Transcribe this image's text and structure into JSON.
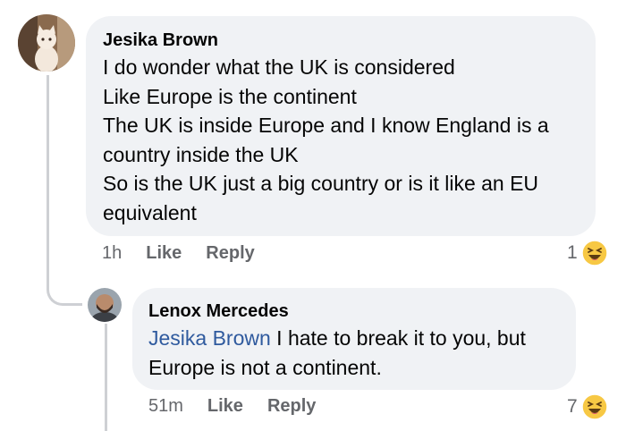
{
  "comments": [
    {
      "author": "Jesika Brown",
      "avatar_icon": "cat-photo-avatar",
      "lines": [
        "I do wonder what the UK is considered",
        "Like Europe is the continent",
        "The UK is inside Europe and I know England is a",
        "country inside the UK",
        "So is the UK just a big country or is it like an EU",
        "equivalent"
      ],
      "time": "1h",
      "like_label": "Like",
      "reply_label": "Reply",
      "reaction_count": "1",
      "reaction_icon": "laughing-emoji-icon"
    },
    {
      "author": "Lenox Mercedes",
      "avatar_icon": "man-photo-avatar",
      "mention": "Jesika Brown",
      "first_line_rest": " I hate to break it to you, but",
      "lines": [
        "Europe is not a continent."
      ],
      "time": "51m",
      "like_label": "Like",
      "reply_label": "Reply",
      "reaction_count": "7",
      "reaction_icon": "laughing-emoji-icon"
    }
  ],
  "colors": {
    "bubble": "#f0f2f5",
    "meta": "#65676b",
    "mention": "#2f5a9e",
    "thread_line": "#ced0d4"
  }
}
